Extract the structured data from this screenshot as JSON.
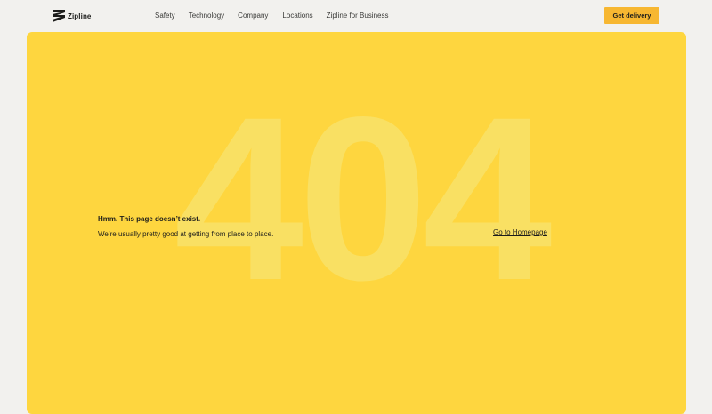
{
  "header": {
    "logo_text": "Zipline",
    "logo_icon": "zipline-logo-icon",
    "nav": [
      {
        "label": "Safety"
      },
      {
        "label": "Technology"
      },
      {
        "label": "Company"
      },
      {
        "label": "Locations"
      },
      {
        "label": "Zipline for Business"
      }
    ],
    "cta_label": "Get delivery"
  },
  "main": {
    "code": "404",
    "title": "Hmm. This page doesn’t exist.",
    "body": "We’re usually pretty good at getting from place to place.",
    "home_link": "Go to Homepage"
  },
  "colors": {
    "page_bg": "#f2f1ee",
    "panel_bg": "#fed63f",
    "code_text": "#f9e26a",
    "cta_bg": "#f7b731",
    "text": "#1d1d1b"
  }
}
